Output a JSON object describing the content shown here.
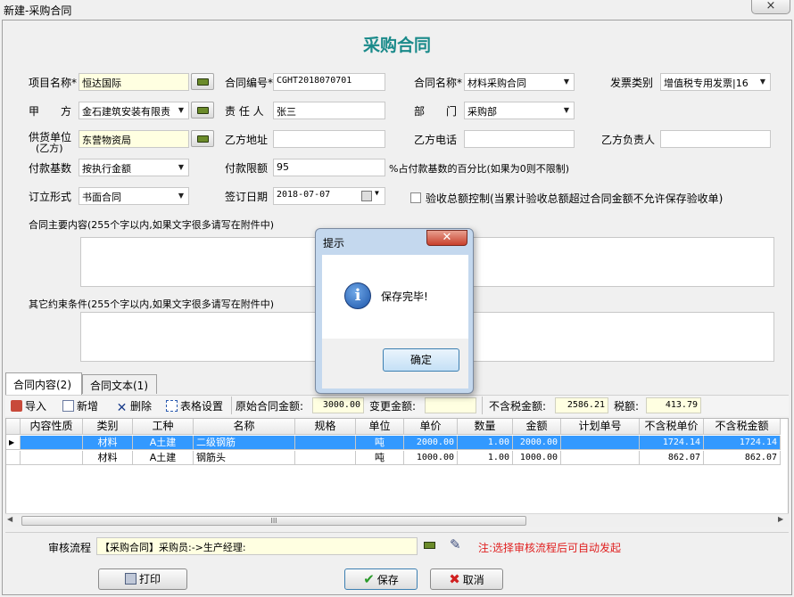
{
  "window": {
    "title": "新建-采购合同",
    "close": "×"
  },
  "heading": "采购合同",
  "form": {
    "project_name": {
      "label": "项目名称*",
      "value": "恒达国际"
    },
    "contract_no": {
      "label": "合同编号*",
      "value": "CGHT2018070701"
    },
    "contract_name": {
      "label": "合同名称*",
      "value": "材料采购合同"
    },
    "invoice_type": {
      "label": "发票类别",
      "value": "增值税专用发票|16"
    },
    "party_a": {
      "label": "甲　　方",
      "value": "金石建筑安装有限责"
    },
    "person_in_charge": {
      "label": "责 任 人",
      "value": "张三"
    },
    "department": {
      "label": "部　　门",
      "value": "采购部"
    },
    "supplier": {
      "label": "供货单位",
      "label2": "(乙方)",
      "value": "东营物资局"
    },
    "party_b_address": {
      "label": "乙方地址",
      "value": ""
    },
    "party_b_phone": {
      "label": "乙方电话",
      "value": ""
    },
    "party_b_manager": {
      "label": "乙方负责人",
      "value": ""
    },
    "payment_base": {
      "label": "付款基数",
      "value": "按执行金额"
    },
    "payment_limit": {
      "label": "付款限额",
      "value": "95",
      "hint": "%占付款基数的百分比(如果为0则不限制)"
    },
    "contract_form": {
      "label": "订立形式",
      "value": "书面合同"
    },
    "sign_date": {
      "label": "签订日期",
      "value": "2018-07-07"
    },
    "acceptance_control": {
      "label": "验收总额控制(当累计验收总额超过合同金额不允许保存验收单)",
      "checked": false
    },
    "main_content": {
      "label": "合同主要内容(255个字以内,如果文字很多请写在附件中)",
      "value": ""
    },
    "other_terms": {
      "label": "其它约束条件(255个字以内,如果文字很多请写在附件中)",
      "value": ""
    }
  },
  "tabs": [
    {
      "label": "合同内容(2)",
      "active": true
    },
    {
      "label": "合同文本(1)",
      "active": false
    }
  ],
  "toolbar": {
    "import": "导入",
    "add": "新增",
    "delete": "删除",
    "table_settings": "表格设置",
    "original_amount_label": "原始合同金额:",
    "original_amount": "3000.00",
    "change_amount_label": "变更金额:",
    "change_amount": "",
    "no_tax_label": "不含税金额:",
    "no_tax": "2586.21",
    "tax_label": "税额:",
    "tax": "413.79"
  },
  "table": {
    "columns": [
      "内容性质",
      "类别",
      "工种",
      "名称",
      "规格",
      "单位",
      "单价",
      "数量",
      "金额",
      "计划单号",
      "不含税单价",
      "不含税金额"
    ],
    "rows": [
      [
        "",
        "材料",
        "A土建",
        "二级钢筋",
        "",
        "吨",
        "2000.00",
        "1.00",
        "2000.00",
        "",
        "1724.14",
        "1724.14"
      ],
      [
        "",
        "材料",
        "A土建",
        "钢筋头",
        "",
        "吨",
        "1000.00",
        "1.00",
        "1000.00",
        "",
        "862.07",
        "862.07"
      ]
    ]
  },
  "scroll_grip": "III",
  "approval": {
    "label": "审核流程",
    "value": "【采购合同】采购员:->生产经理:",
    "note": "注:选择审核流程后可自动发起"
  },
  "buttons": {
    "print": "打印",
    "save": "保存",
    "cancel": "取消"
  },
  "dialog": {
    "title": "提示",
    "message": "保存完毕!",
    "ok": "确定",
    "icon_char": "i"
  }
}
